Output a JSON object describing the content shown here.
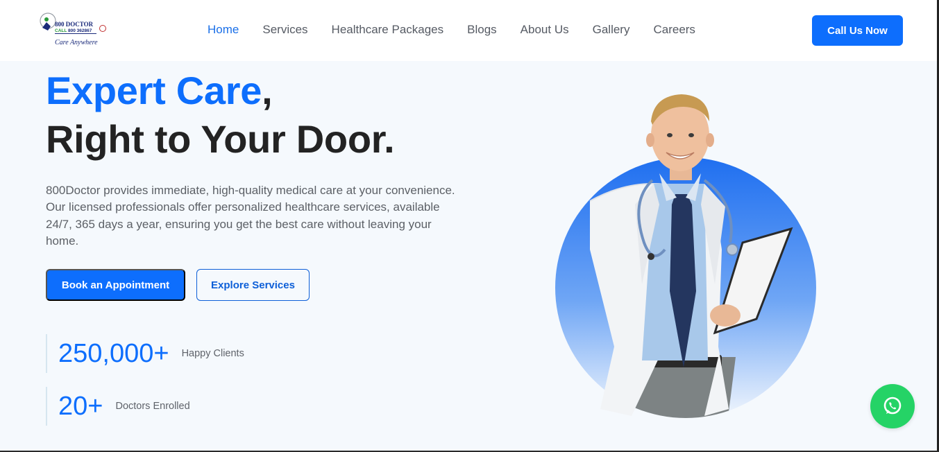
{
  "brand": {
    "logo_top": "800 DOCTOR",
    "logo_call_prefix": "CALL",
    "logo_call_number": "800 362867",
    "logo_tagline": "Care Anywhere"
  },
  "nav": {
    "items": [
      {
        "label": "Home",
        "active": true
      },
      {
        "label": "Services"
      },
      {
        "label": "Healthcare Packages"
      },
      {
        "label": "Blogs"
      },
      {
        "label": "About Us"
      },
      {
        "label": "Gallery"
      },
      {
        "label": "Careers"
      }
    ],
    "cta": "Call Us Now"
  },
  "hero": {
    "title_accent": "Expert Care",
    "title_comma": ",",
    "title_line2": "Right to Your Door.",
    "description": "800Doctor provides immediate, high-quality medical care at your convenience. Our licensed professionals offer personalized healthcare services, available 24/7, 365 days a year, ensuring you get the best care without leaving your home.",
    "primary_button": "Book an Appointment",
    "secondary_button": "Explore Services"
  },
  "stats": [
    {
      "value": "250,000+",
      "label": "Happy Clients"
    },
    {
      "value": "20+",
      "label": "Doctors Enrolled"
    }
  ],
  "colors": {
    "accent": "#0d6efd",
    "whatsapp": "#25d366",
    "text_dark": "#222222"
  },
  "icons": {
    "whatsapp": "whatsapp-icon",
    "logo": "doctor-logo-icon"
  }
}
